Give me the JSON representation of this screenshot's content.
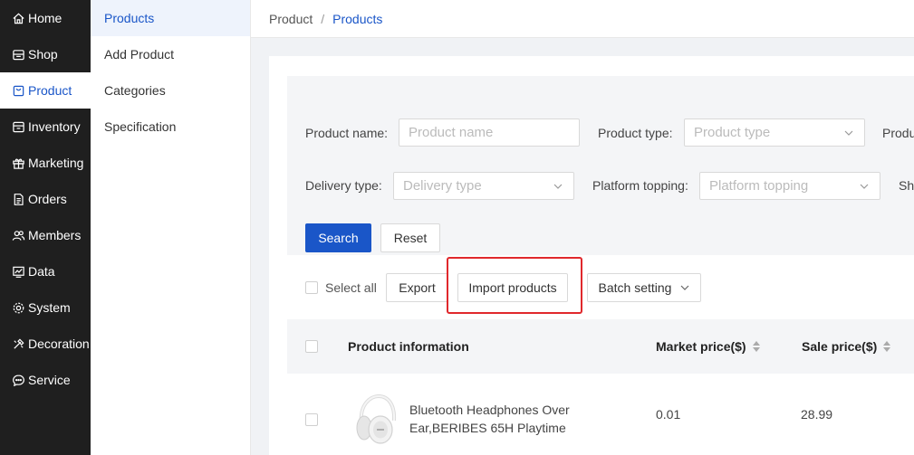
{
  "nav": {
    "items": [
      {
        "label": "Home",
        "icon": "home-icon"
      },
      {
        "label": "Shop",
        "icon": "shop-icon"
      },
      {
        "label": "Product",
        "icon": "product-icon",
        "active": true
      },
      {
        "label": "Inventory",
        "icon": "inventory-icon"
      },
      {
        "label": "Marketing",
        "icon": "gift-icon"
      },
      {
        "label": "Orders",
        "icon": "orders-icon"
      },
      {
        "label": "Members",
        "icon": "members-icon"
      },
      {
        "label": "Data",
        "icon": "data-chart-icon"
      },
      {
        "label": "System",
        "icon": "gear-icon"
      },
      {
        "label": "Decoration",
        "icon": "decoration-icon"
      },
      {
        "label": "Service",
        "icon": "chat-icon"
      }
    ]
  },
  "submenu": {
    "items": [
      {
        "label": "Products",
        "active": true
      },
      {
        "label": "Add Product"
      },
      {
        "label": "Categories"
      },
      {
        "label": "Specification"
      }
    ]
  },
  "breadcrumb": {
    "parent": "Product",
    "separator": "/",
    "current": "Products"
  },
  "filters": {
    "product_name": {
      "label": "Product name:",
      "placeholder": "Product name"
    },
    "product_type": {
      "label": "Product type:",
      "placeholder": "Product type"
    },
    "third_label_partial": "Produ",
    "delivery_type": {
      "label": "Delivery type:",
      "placeholder": "Delivery type"
    },
    "platform_topping": {
      "label": "Platform topping:",
      "placeholder": "Platform topping"
    },
    "fourth_label_partial": "Sh",
    "search_label": "Search",
    "reset_label": "Reset"
  },
  "actions": {
    "select_all_label": "Select all",
    "export_label": "Export",
    "import_label": "Import products",
    "batch_label": "Batch setting"
  },
  "table": {
    "columns": {
      "product_info": "Product information",
      "market_price": "Market price($)",
      "sale_price": "Sale price($)"
    },
    "rows": [
      {
        "name": "Bluetooth Headphones Over Ear,BERIBES 65H Playtime",
        "market_price": "0.01",
        "sale_price": "28.99"
      }
    ]
  },
  "colors": {
    "accent": "#1a56c8",
    "nav_bg": "#1f1f1f",
    "highlight": "#e0282c"
  }
}
